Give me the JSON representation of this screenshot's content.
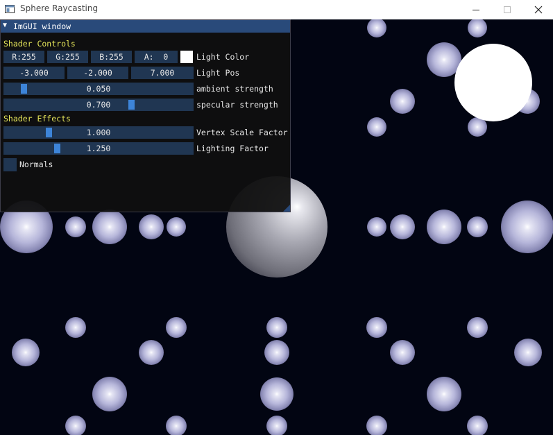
{
  "window": {
    "title": "Sphere Raycasting"
  },
  "imgui": {
    "title": "ImGUI window",
    "sections": {
      "shader_controls": "Shader Controls",
      "shader_effects": "Shader Effects"
    },
    "light_color": {
      "label": "Light Color",
      "r": "R:255",
      "g": "G:255",
      "b": "B:255",
      "a": "A:  0",
      "swatch_color": "#ffffff"
    },
    "light_pos": {
      "label": "Light Pos",
      "x": "-3.000",
      "y": "-2.000",
      "z": "7.000"
    },
    "ambient": {
      "label": "ambient strength",
      "value": "0.050",
      "fraction": 0.05
    },
    "specular": {
      "label": "specular strength",
      "value": "0.700",
      "fraction": 0.7
    },
    "vertex_scale": {
      "label": "Vertex Scale Factor",
      "value": "1.000",
      "fraction": 0.2
    },
    "lighting_factor": {
      "label": "Lighting Factor",
      "value": "1.250",
      "fraction": 0.25
    },
    "normals": {
      "label": "Normals",
      "checked": false
    }
  },
  "colors": {
    "sphere": "#b8b8dc",
    "background": "#020512",
    "accent": "#3d84d8"
  }
}
